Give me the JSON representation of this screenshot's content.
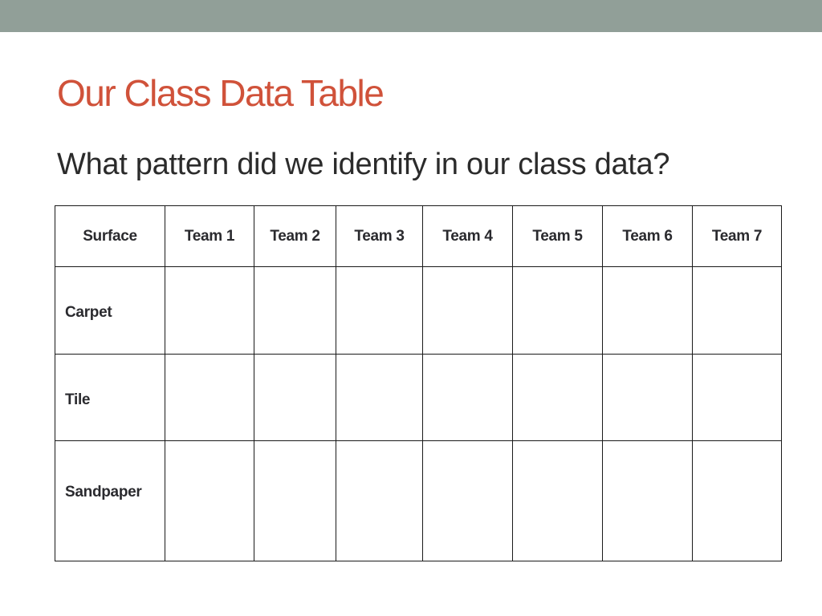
{
  "slide": {
    "title": "Our Class Data Table",
    "subtitle": "What pattern did we identify in our class data?",
    "colors": {
      "header_band": "#919f98",
      "title": "#d0523a",
      "body_text": "#2b2b2b",
      "table_border": "#1a1a1a"
    }
  },
  "table": {
    "headers": [
      "Surface",
      "Team 1",
      "Team 2",
      "Team 3",
      "Team 4",
      "Team 5",
      "Team 6",
      "Team 7"
    ],
    "rows": [
      {
        "label": "Carpet",
        "cells": [
          "",
          "",
          "",
          "",
          "",
          "",
          ""
        ]
      },
      {
        "label": "Tile",
        "cells": [
          "",
          "",
          "",
          "",
          "",
          "",
          ""
        ]
      },
      {
        "label": "Sandpaper",
        "cells": [
          "",
          "",
          "",
          "",
          "",
          "",
          ""
        ]
      }
    ]
  }
}
